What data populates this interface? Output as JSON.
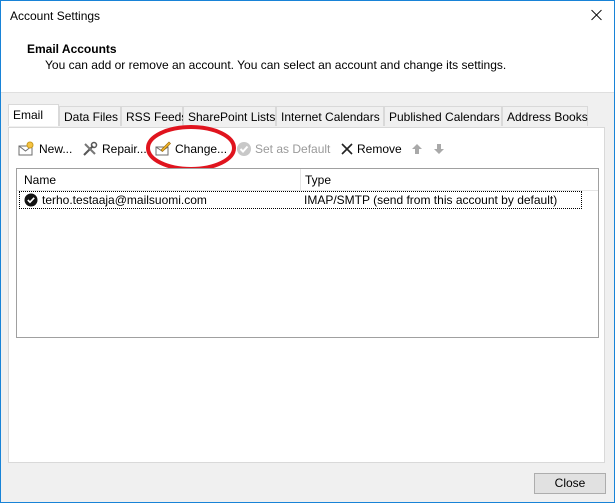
{
  "window": {
    "title": "Account Settings"
  },
  "header": {
    "title": "Email Accounts",
    "description": "You can add or remove an account. You can select an account and change its settings."
  },
  "tabs": [
    {
      "label": "Email",
      "active": true
    },
    {
      "label": "Data Files"
    },
    {
      "label": "RSS Feeds"
    },
    {
      "label": "SharePoint Lists"
    },
    {
      "label": "Internet Calendars"
    },
    {
      "label": "Published Calendars"
    },
    {
      "label": "Address Books"
    }
  ],
  "toolbar": {
    "new_label": "New...",
    "repair_label": "Repair...",
    "change_label": "Change...",
    "set_default_label": "Set as Default",
    "remove_label": "Remove"
  },
  "accounts": {
    "columns": [
      "Name",
      "Type"
    ],
    "rows": [
      {
        "name": "terho.testaaja@mailsuomi.com",
        "type": "IMAP/SMTP (send from this account by default)",
        "default": true
      }
    ]
  },
  "footer": {
    "close_label": "Close"
  },
  "colors": {
    "window_border": "#1883d7",
    "annotation": "#e0141e"
  }
}
